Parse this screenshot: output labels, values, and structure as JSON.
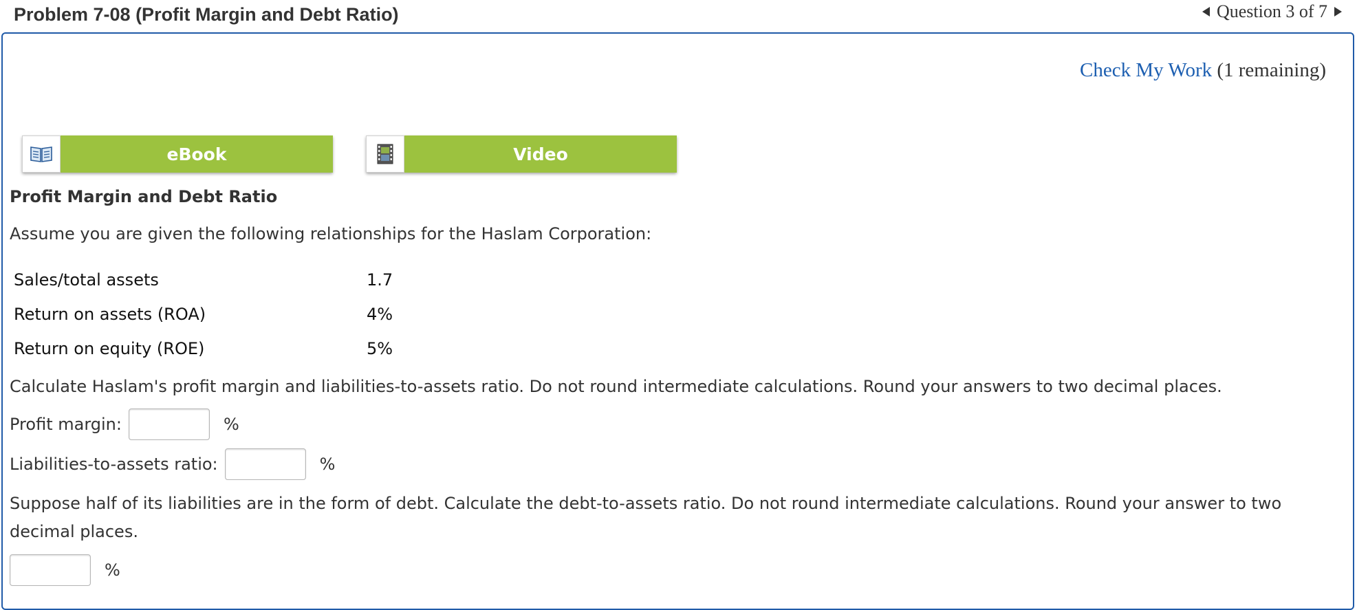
{
  "header": {
    "title": "Problem 7-08 (Profit Margin and Debt Ratio)",
    "question_nav": "Question 3 of 7"
  },
  "check": {
    "link": "Check My Work",
    "remaining": "(1 remaining)"
  },
  "resources": {
    "ebook_label": "eBook",
    "video_label": "Video",
    "ebook_icon": "book-icon",
    "video_icon": "film-icon"
  },
  "content": {
    "section_title": "Profit Margin and Debt Ratio",
    "intro": "Assume you are given the following relationships for the Haslam Corporation:",
    "table": [
      {
        "label": "Sales/total assets",
        "value": "1.7"
      },
      {
        "label": "Return on assets (ROA)",
        "value": "4%"
      },
      {
        "label": "Return on equity (ROE)",
        "value": "5%"
      }
    ],
    "instruction1": "Calculate Haslam's profit margin and liabilities-to-assets ratio. Do not round intermediate calculations. Round your answers to two decimal places.",
    "profit_margin_label": "Profit margin:",
    "liabilities_label": "Liabilities-to-assets ratio:",
    "percent": "%",
    "instruction2_line1": "Suppose half of its liabilities are in the form of debt. Calculate the debt-to-assets ratio. Do not round intermediate calculations. Round your answer to two",
    "instruction2_line2": "decimal places.",
    "profit_margin_value": "",
    "liabilities_value": "",
    "debt_value": ""
  },
  "colors": {
    "accent_green": "#9cc23f",
    "link_blue": "#1d5fb1",
    "panel_border": "#1f5aa8"
  }
}
